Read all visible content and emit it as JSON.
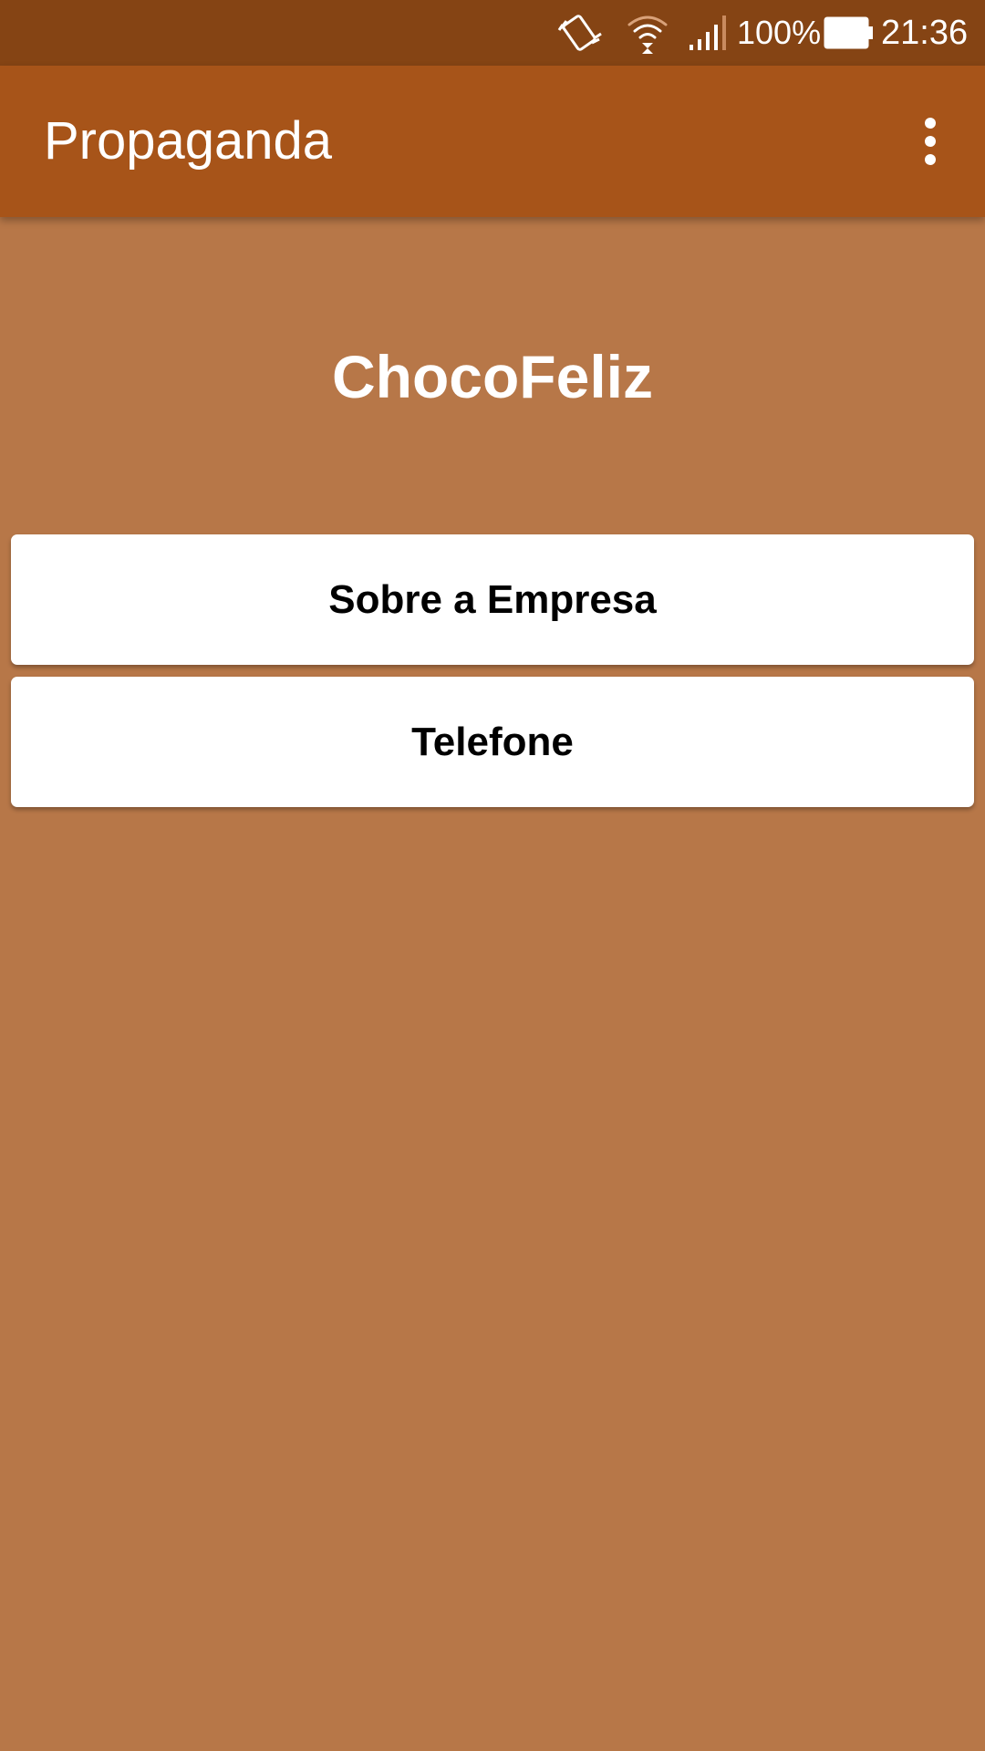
{
  "status_bar": {
    "icons": [
      "vibrate-icon",
      "wifi-icon",
      "cell-signal-icon",
      "battery-icon"
    ],
    "battery_percent": "100%",
    "time": "21:36"
  },
  "app_bar": {
    "title": "Propaganda",
    "overflow_icon": "more-vert-icon"
  },
  "main": {
    "brand_title": "ChocoFeliz",
    "buttons": [
      {
        "label": "Sobre a Empresa"
      },
      {
        "label": "Telefone"
      }
    ]
  },
  "colors": {
    "status_bar": "#854414",
    "app_bar": "#a75419",
    "background": "#b77748",
    "button_bg": "#ffffff",
    "button_text": "#000000",
    "title_text": "#ffffff"
  }
}
